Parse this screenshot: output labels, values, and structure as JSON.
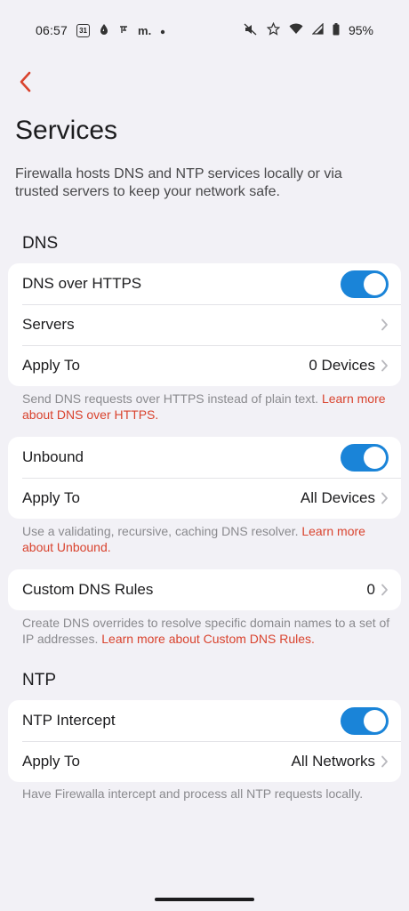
{
  "status_bar": {
    "time": "06:57",
    "calendar_day": "31",
    "letters": "m.",
    "battery": "95%"
  },
  "title": "Services",
  "description": "Firewalla hosts DNS and NTP services locally or via trusted servers to keep your network safe.",
  "dns": {
    "header": "DNS",
    "doh_card": {
      "toggle_label": "DNS over HTTPS",
      "toggle_on": true,
      "servers_label": "Servers",
      "apply_label": "Apply To",
      "apply_value": "0 Devices"
    },
    "doh_note": "Send DNS requests over HTTPS instead of plain text. ",
    "doh_link": "Learn more about DNS over HTTPS.",
    "unbound_card": {
      "toggle_label": "Unbound",
      "toggle_on": true,
      "apply_label": "Apply To",
      "apply_value": "All Devices"
    },
    "unbound_note": "Use a validating, recursive, caching DNS resolver. ",
    "unbound_link": "Learn more about Unbound.",
    "custom_card": {
      "label": "Custom DNS Rules",
      "value": "0"
    },
    "custom_note": "Create DNS overrides to resolve specific domain names to a set of IP addresses. ",
    "custom_link": "Learn more about Custom DNS Rules."
  },
  "ntp": {
    "header": "NTP",
    "card": {
      "toggle_label": "NTP Intercept",
      "toggle_on": true,
      "apply_label": "Apply To",
      "apply_value": "All Networks"
    },
    "note": "Have Firewalla intercept and process all NTP requests locally."
  },
  "colors": {
    "accent": "#d9432e",
    "toggle_on": "#1a84d8",
    "background": "#f2f1f6"
  }
}
